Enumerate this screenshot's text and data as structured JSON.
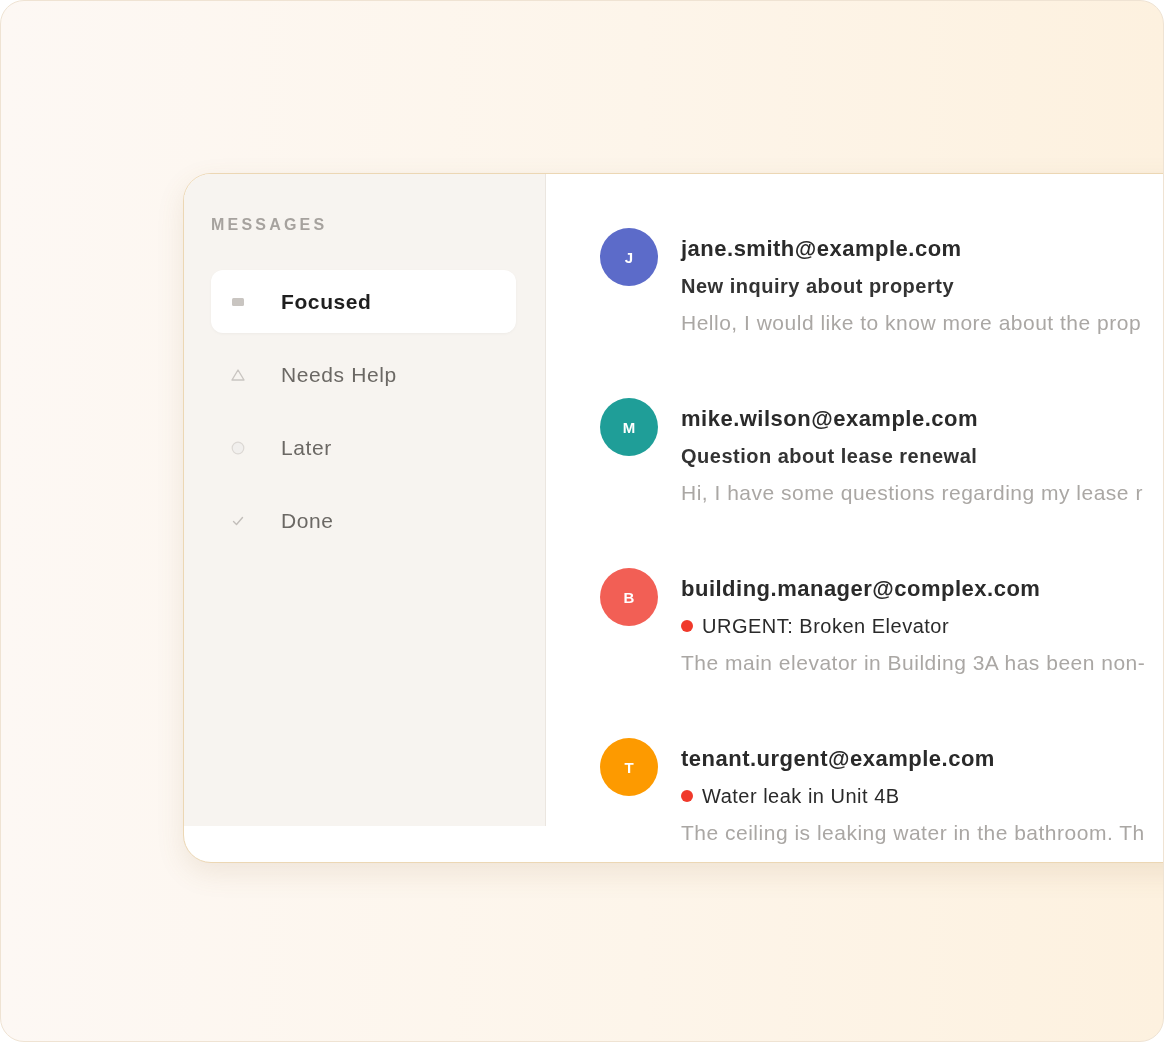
{
  "sidebar": {
    "heading": "MESSAGES",
    "items": [
      {
        "label": "Focused",
        "selected": true
      },
      {
        "label": "Needs Help",
        "selected": false
      },
      {
        "label": "Later",
        "selected": false
      },
      {
        "label": "Done",
        "selected": false
      }
    ]
  },
  "messages": [
    {
      "initial": "J",
      "color": "#5c6bc9",
      "sender": "jane.smith@example.com",
      "urgent": false,
      "subject": "New inquiry about property",
      "preview": "Hello, I would like to know more about the prop"
    },
    {
      "initial": "M",
      "color": "#1f9e98",
      "sender": "mike.wilson@example.com",
      "urgent": false,
      "subject": "Question about lease renewal",
      "preview": "Hi, I have some questions regarding my lease r"
    },
    {
      "initial": "B",
      "color": "#f25f55",
      "sender": "building.manager@complex.com",
      "urgent": true,
      "subject": "URGENT: Broken Elevator",
      "preview": "The main elevator in Building 3A has been non-"
    },
    {
      "initial": "T",
      "color": "#fd9a00",
      "sender": "tenant.urgent@example.com",
      "urgent": true,
      "subject": "Water leak in Unit 4B",
      "preview": "The ceiling is leaking water in the bathroom. Th"
    }
  ]
}
